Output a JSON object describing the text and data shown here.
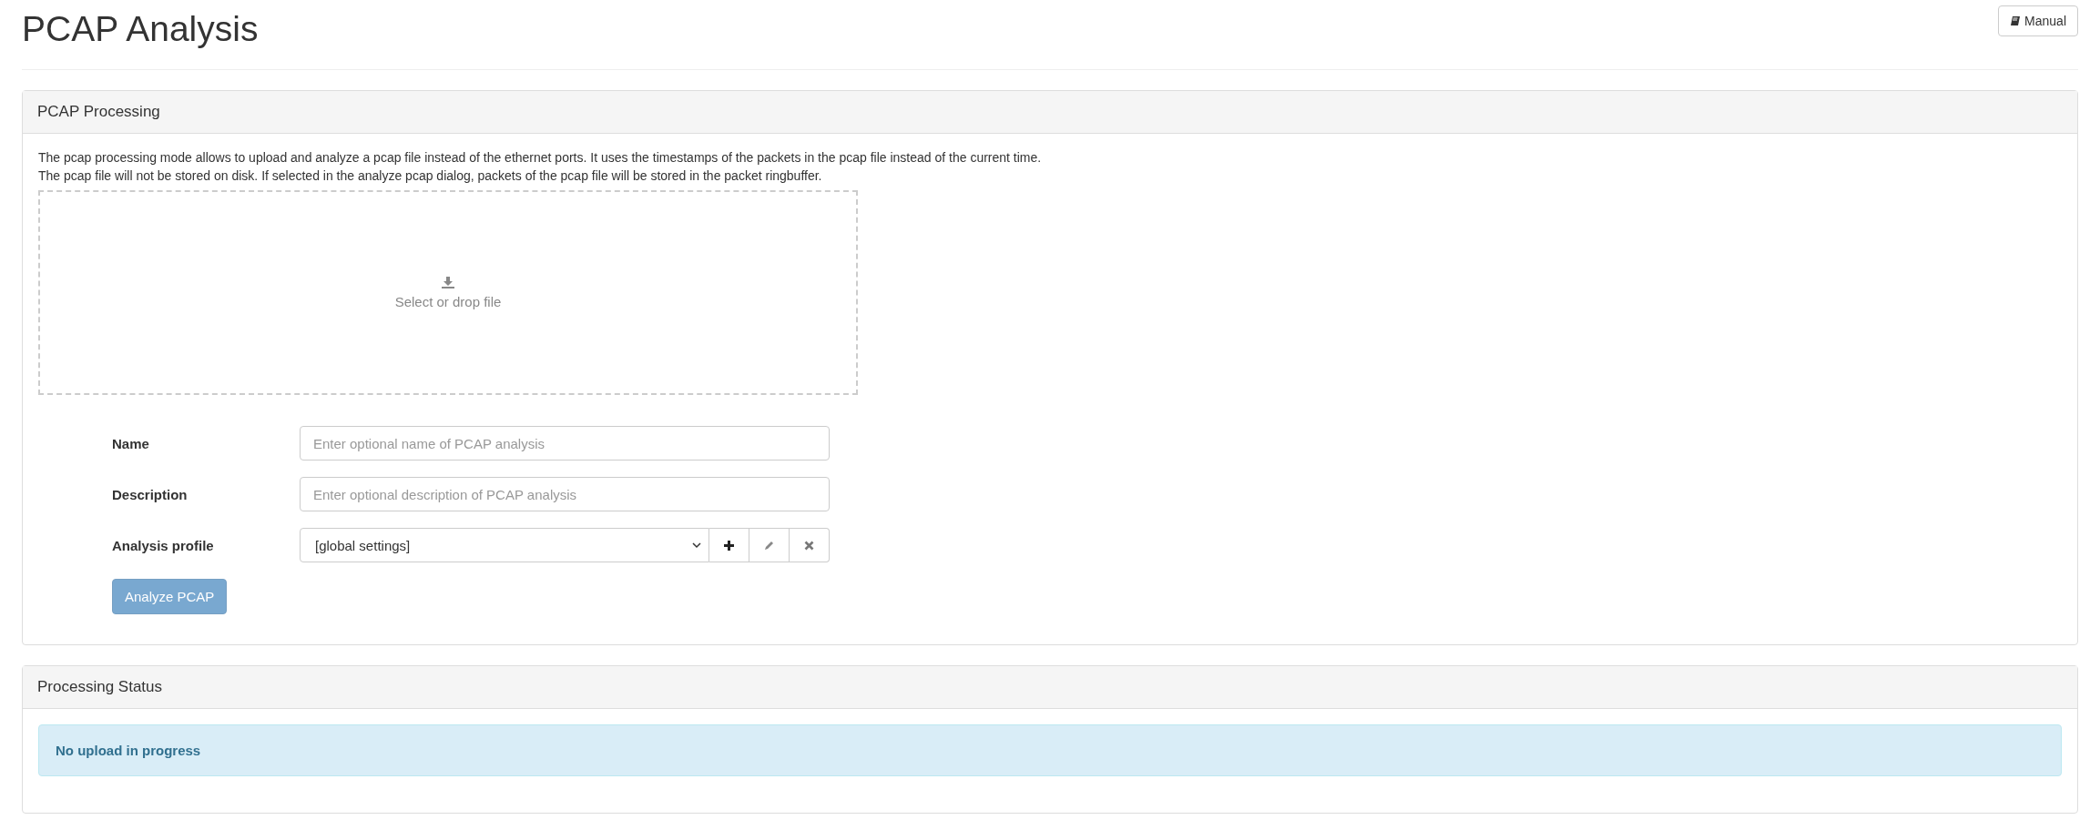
{
  "page": {
    "title": "PCAP Analysis",
    "manual_button": "Manual"
  },
  "processing_panel": {
    "title": "PCAP Processing",
    "description": [
      "The pcap processing mode allows to upload and analyze a pcap file instead of the ethernet ports. It uses the timestamps of the packets in the pcap file instead of the current time.",
      "The pcap file will not be stored on disk. If selected in the analyze pcap dialog, packets of the pcap file will be stored in the packet ringbuffer."
    ],
    "dropzone": {
      "label": "Select or drop file"
    },
    "fields": [
      {
        "kind": "text",
        "label": "Name",
        "placeholder": "Enter optional name of PCAP analysis"
      },
      {
        "kind": "text",
        "label": "Description",
        "placeholder": "Enter optional description of PCAP analysis"
      },
      {
        "kind": "select",
        "label": "Analysis profile",
        "value": "[global settings]"
      }
    ],
    "submit": {
      "label": "Analyze PCAP",
      "disabled": true
    }
  },
  "status_panel": {
    "title": "Processing Status",
    "message": "No upload in progress"
  }
}
